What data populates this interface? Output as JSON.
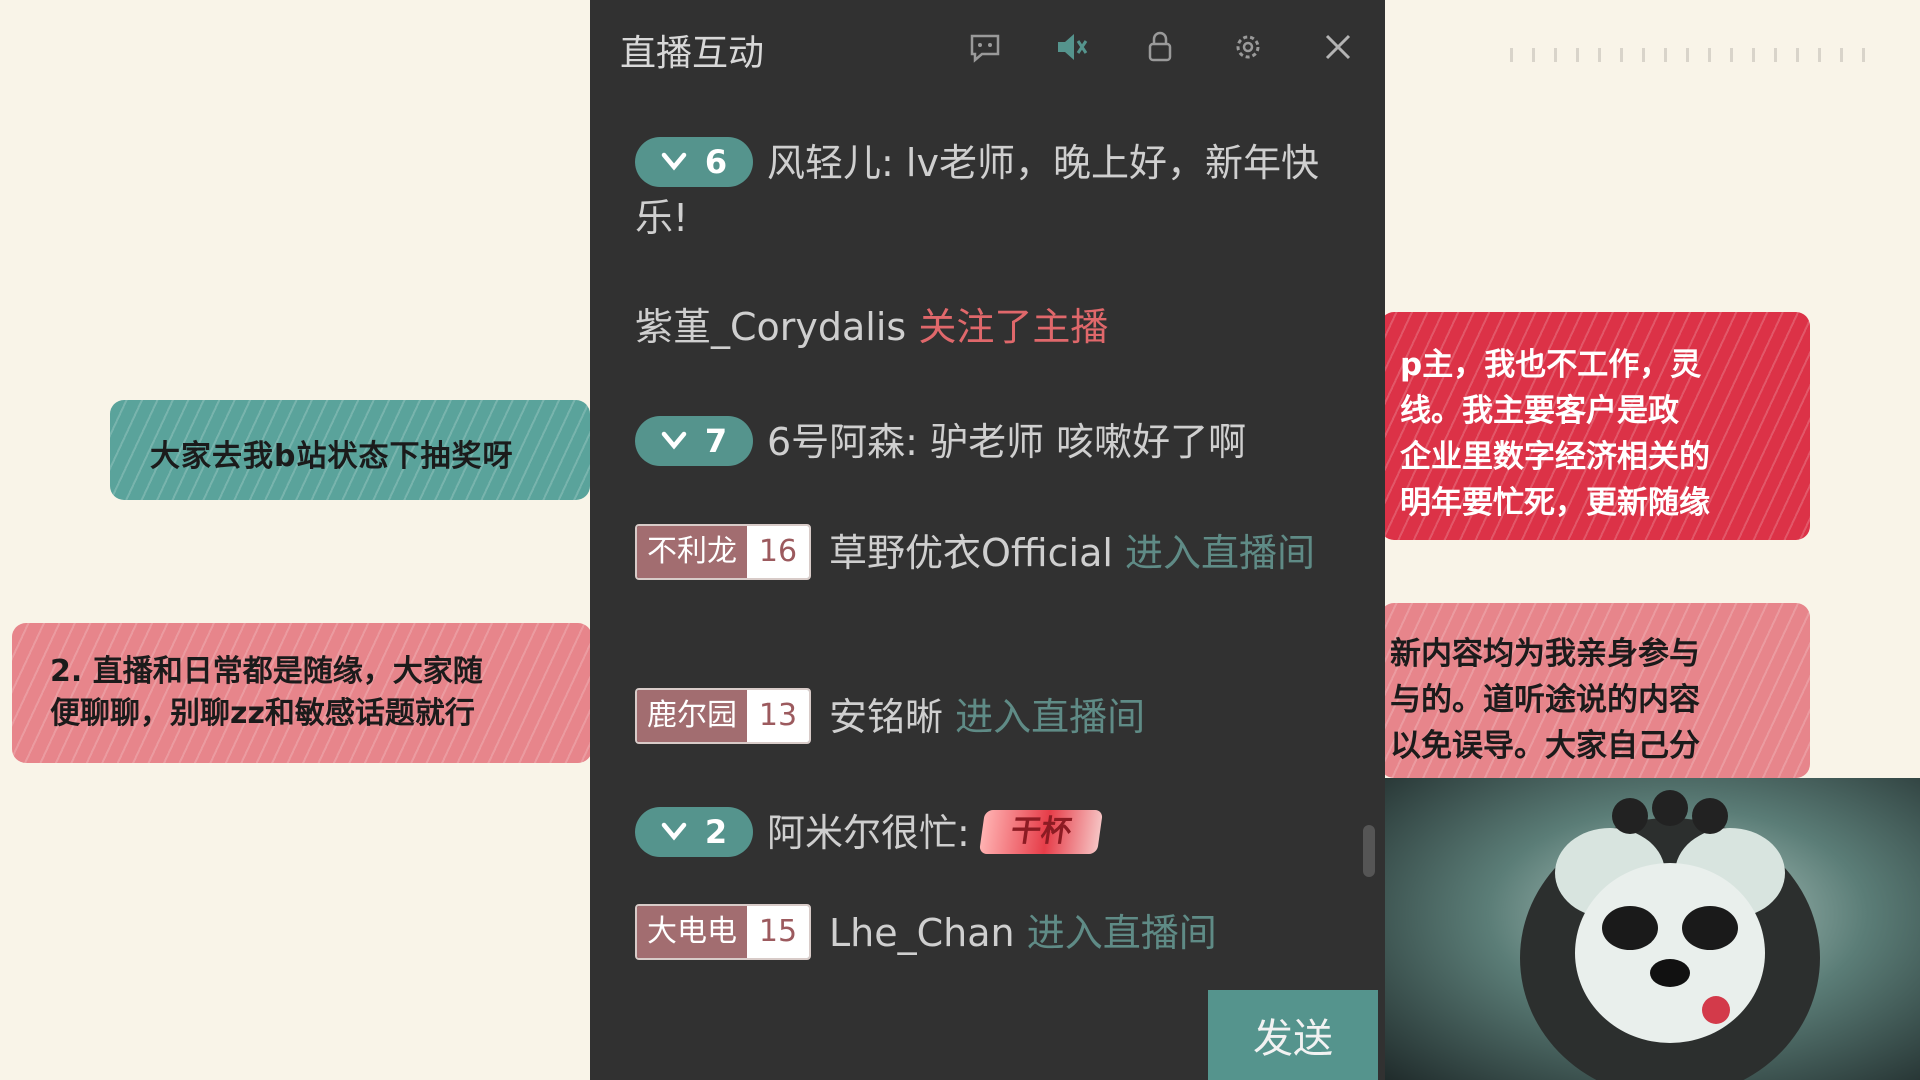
{
  "background_notes": {
    "teal": "大家去我b站状态下抽奖呀",
    "pink_left": [
      "2. 直播和日常都是随缘，大家随",
      "便聊聊，别聊zz和敏感话题就行"
    ],
    "red_right": [
      "p主，我也不工作，灵",
      "线。我主要客户是政",
      "企业里数字经济相关的",
      "明年要忙死，更新随缘"
    ],
    "pink_right": [
      "新内容均为我亲身参与",
      "与的。道听途说的内容",
      "以免误导。大家自己分"
    ]
  },
  "panel": {
    "title": "直播互动",
    "toolbar_icons": [
      "chat-bubble-icon",
      "muted-speaker-icon",
      "lock-icon",
      "settings-icon",
      "close-icon"
    ],
    "messages": [
      {
        "level": "6",
        "user": "风轻儿:",
        "text": " lv老师，晚上好，新年快乐!"
      },
      {
        "user": "紫堇_Corydalis",
        "action": "关注了主播"
      },
      {
        "level": "7",
        "user": "6号阿森:",
        "text": " 驴老师 咳嗽好了啊"
      },
      {
        "fan_name": "不利龙",
        "fan_level": "16",
        "user": "草野优衣Official",
        "action": "进入直播间"
      },
      {
        "fan_name": "鹿尔园",
        "fan_level": "13",
        "user": "安铭晰",
        "action": "进入直播间"
      },
      {
        "level": "2",
        "user": "阿米尔很忙:",
        "sticker": "干杯"
      },
      {
        "fan_name": "大电电",
        "fan_level": "15",
        "user": "Lhe_Chan",
        "action": "进入直播间"
      }
    ],
    "send_label": "发送"
  },
  "colors": {
    "panel_bg": "#313131",
    "accent_teal": "#55948d",
    "follow_red": "#e0686b",
    "enter_teal": "#5f8b86",
    "fan_badge": "#a26d70"
  }
}
